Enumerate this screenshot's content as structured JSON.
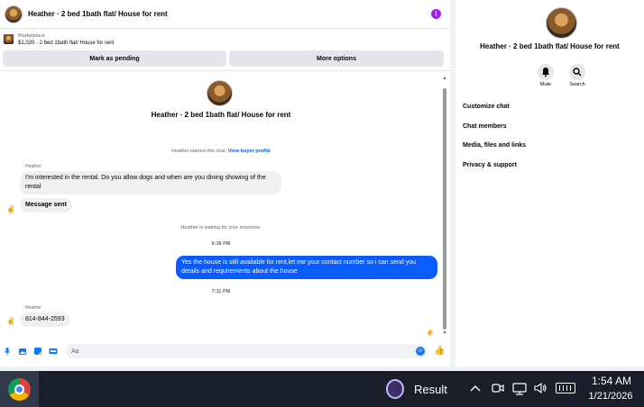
{
  "chat": {
    "header_title": "Heather · 2 bed 1bath flat/ House for rent",
    "listing_category": "Marketplace",
    "listing_price_title": "$1,020 · 2 bed 1bath flat/ House for rent",
    "mark_pending_label": "Mark as pending",
    "more_options_label": "More options",
    "thread_title": "Heather · 2 bed 1bath flat/ House for rent",
    "started_text": "Heather started this chat.",
    "view_buyer_profile": "View buyer profile",
    "messages": [
      {
        "sender": "Heather",
        "text": "I'm interested in the rental. Do you allow dogs and when are you dining showing of the rental"
      },
      {
        "text": "Message sent"
      },
      {
        "system": "Heather is waiting for your response."
      },
      {
        "time": "6:38 PM"
      },
      {
        "outgoing": "Yes the house is still available for rent,let me your contact number so i can send you details and requirements about the house"
      },
      {
        "time": "7:11 PM"
      },
      {
        "sender": "Heather",
        "text": "814-844-2593"
      }
    ],
    "composer_placeholder": "Aa",
    "icons": {
      "info": "info-icon",
      "mic": "microphone-icon",
      "image": "image-icon",
      "sticker": "sticker-icon",
      "gif": "gif-icon",
      "emoji": "emoji-icon",
      "like": "thumbs-up-icon"
    }
  },
  "right_panel": {
    "title": "Heather · 2 bed 1bath flat/ House for rent",
    "mute_label": "Mute",
    "search_label": "Search",
    "items": [
      "Customize chat",
      "Chat members",
      "Media, files and links",
      "Privacy & support"
    ]
  },
  "taskbar": {
    "result_label": "Result",
    "time": "1:54 AM",
    "date": "1/21/2026"
  },
  "colors": {
    "accent": "#0a5cff",
    "info_purple": "#a020f0",
    "panel_bg": "#f0f2f5",
    "taskbar_bg": "#1a1d2a"
  }
}
